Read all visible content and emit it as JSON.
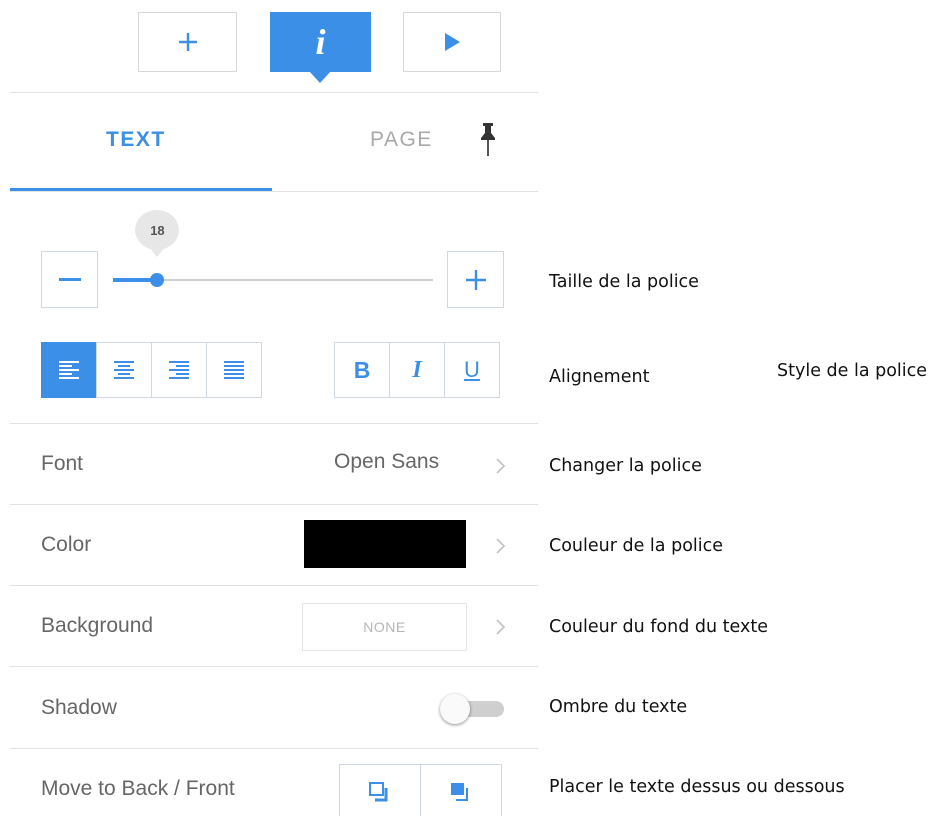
{
  "toolbar": {
    "add_icon": "plus-icon",
    "info_icon": "info-icon",
    "info_label": "i",
    "play_icon": "play-icon",
    "accent_color": "#3b8fe6"
  },
  "tabs": [
    {
      "label": "TEXT",
      "active": true
    },
    {
      "label": "PAGE",
      "active": false
    }
  ],
  "pin_icon": "pin-icon",
  "font_size": {
    "value": "18",
    "min": 8,
    "max": 80,
    "current": 18
  },
  "style_buttons": {
    "bold": "B",
    "italic": "I",
    "underline": "U"
  },
  "rows": {
    "font": {
      "label": "Font",
      "value": "Open Sans"
    },
    "color": {
      "label": "Color",
      "swatch": "#000000"
    },
    "background": {
      "label": "Background",
      "value": "NONE"
    },
    "shadow": {
      "label": "Shadow",
      "enabled": false
    },
    "layer": {
      "label": "Move to Back / Front"
    }
  },
  "annotations": {
    "size": "Taille de la police",
    "alignment": "Alignement",
    "style": "Style de la police",
    "font": "Changer la police",
    "color": "Couleur de la police",
    "background": "Couleur du fond du texte",
    "shadow": "Ombre du texte",
    "layer": "Placer le texte dessus ou dessous"
  }
}
